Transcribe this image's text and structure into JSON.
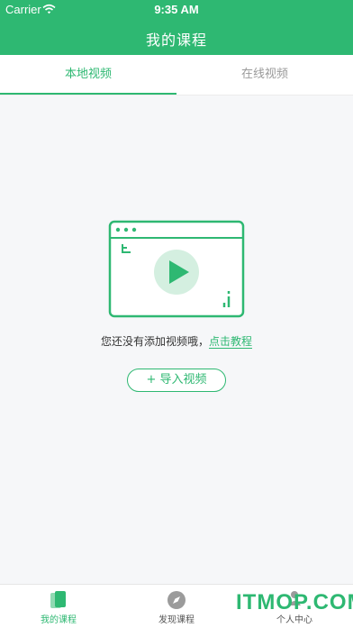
{
  "status_bar": {
    "carrier": "Carrier",
    "time": "9:35 AM"
  },
  "nav": {
    "title": "我的课程"
  },
  "tabs": [
    {
      "label": "本地视频",
      "active": true
    },
    {
      "label": "在线视频",
      "active": false
    }
  ],
  "empty_state": {
    "message": "您还没有添加视频哦，",
    "link": "点击教程",
    "import_button": "+ 导入视频"
  },
  "tabbar": [
    {
      "label": "我的课程",
      "icon": "cards-icon",
      "active": true
    },
    {
      "label": "发现课程",
      "icon": "compass-icon",
      "active": false
    },
    {
      "label": "个人中心",
      "icon": "person-icon",
      "active": false
    }
  ],
  "watermark": "ITMOP.COM",
  "colors": {
    "accent": "#2eb872",
    "background": "#f6f7f9"
  }
}
